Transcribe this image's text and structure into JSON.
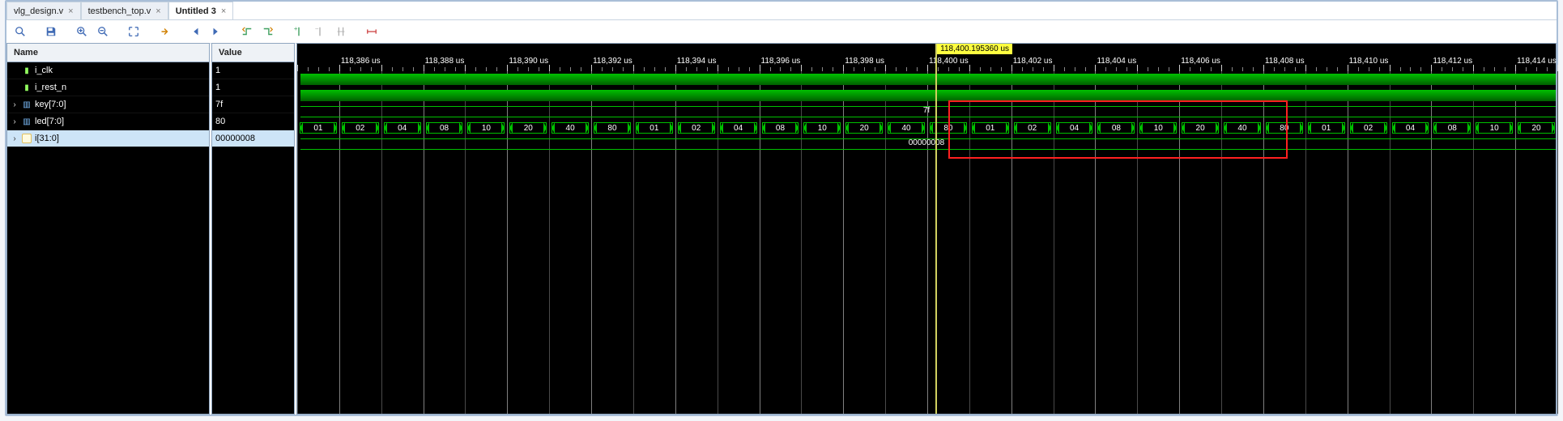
{
  "tabs": [
    {
      "label": "vlg_design.v",
      "active": false
    },
    {
      "label": "testbench_top.v",
      "active": false
    },
    {
      "label": "Untitled 3",
      "active": true
    }
  ],
  "toolbar_icons": [
    "search-icon",
    "save-icon",
    "zoom-in-icon",
    "zoom-out-icon",
    "zoom-fit-icon",
    "go-to-cursor-icon",
    "go-first-icon",
    "go-last-icon",
    "prev-edge-icon",
    "next-edge-icon",
    "add-marker-icon",
    "remove-marker-icon",
    "swap-marker-icon",
    "ruler-icon"
  ],
  "columns": {
    "name_header": "Name",
    "value_header": "Value"
  },
  "signals": [
    {
      "name": "i_clk",
      "value": "1",
      "type": "scalar",
      "expandable": false
    },
    {
      "name": "i_rest_n",
      "value": "1",
      "type": "scalar",
      "expandable": false
    },
    {
      "name": "key[7:0]",
      "value": "7f",
      "type": "bus",
      "expandable": true
    },
    {
      "name": "led[7:0]",
      "value": "80",
      "type": "bus",
      "expandable": true
    },
    {
      "name": "i[31:0]",
      "value": "00000008",
      "type": "bus",
      "expandable": true,
      "selected": true
    }
  ],
  "ruler": {
    "ticks": [
      "118,386 us",
      "118,388 us",
      "118,390 us",
      "118,392 us",
      "118,394 us",
      "118,396 us",
      "118,398 us",
      "118,400 us",
      "118,402 us",
      "118,404 us",
      "118,406 us",
      "118,408 us",
      "118,410 us",
      "118,412 us",
      "118,414 us"
    ],
    "marker_label": "118,400.195360 us",
    "cursor_pos_pct": 38.6
  },
  "chart_data": {
    "type": "waveform",
    "time_range_us": [
      118385.0,
      118415.0
    ],
    "cursor_us": 118400.19536,
    "lanes": [
      {
        "signal": "i_clk",
        "kind": "clock-high-fill"
      },
      {
        "signal": "i_rest_n",
        "kind": "clock-high-fill"
      },
      {
        "signal": "key[7:0]",
        "kind": "bus-flat",
        "value": "7f"
      },
      {
        "signal": "led[7:0]",
        "kind": "bus-seq",
        "pattern": [
          "01",
          "02",
          "04",
          "08",
          "10",
          "20",
          "40",
          "80"
        ],
        "repeats": 4,
        "first_visible_index": 0
      },
      {
        "signal": "i[31:0]",
        "kind": "bus-flat",
        "value": "00000008"
      }
    ],
    "annotation_box": {
      "start_us": 118400.5,
      "end_us": 118408.5,
      "lanes": [
        "key[7:0]",
        "led[7:0]",
        "i[31:0]"
      ]
    }
  }
}
